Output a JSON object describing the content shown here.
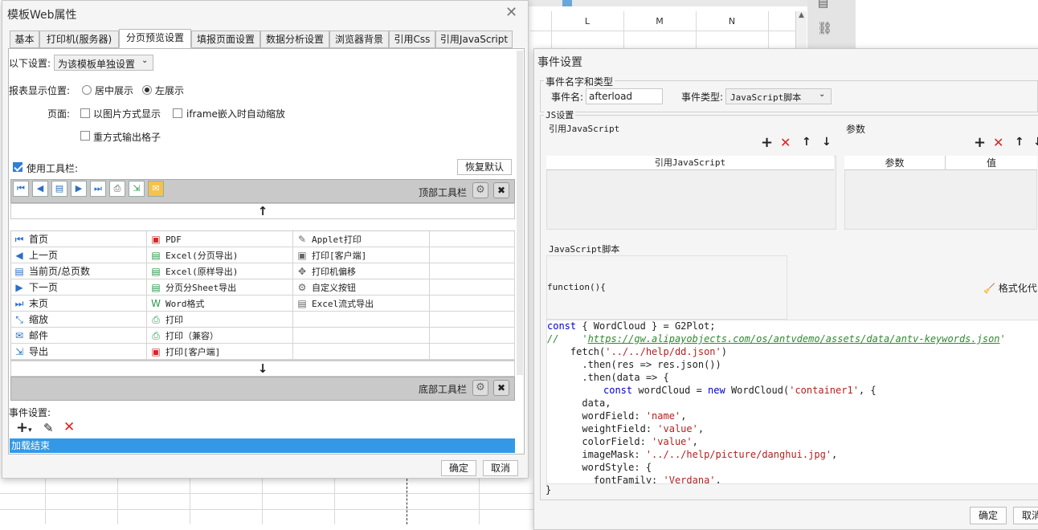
{
  "spreadsheet": {
    "columns": [
      "L",
      "M",
      "N"
    ]
  },
  "left_dialog": {
    "title": "模板Web属性",
    "tabs": [
      "基本",
      "打印机(服务器)",
      "分页预览设置",
      "填报页面设置",
      "数据分析设置",
      "浏览器背景",
      "引用Css",
      "引用JavaScript"
    ],
    "settings_label": "以下设置:",
    "settings_value": "为该模板单独设置",
    "position_label": "报表显示位置:",
    "position_center": "居中展示",
    "position_left": "左展示",
    "page_label": "页面:",
    "opt_image": "以图片方式显示",
    "opt_iframe": "iframe嵌入时自动缩放",
    "opt_grid": "重方式输出格子",
    "use_toolbar": "使用工具栏:",
    "restore_default": "恢复默认",
    "top_toolbar": "顶部工具栏",
    "bottom_toolbar": "底部工具栏",
    "up_arrow": "↑",
    "down_arrow": "↓",
    "col1": [
      "首页",
      "上一页",
      "当前页/总页数",
      "下一页",
      "末页",
      "缩放",
      "邮件",
      "导出"
    ],
    "col2": [
      "PDF",
      "Excel(分页导出)",
      "Excel(原样导出)",
      "分页分Sheet导出",
      "Word格式",
      "打印",
      "打印（兼容）",
      "打印[客户端]"
    ],
    "col3": [
      "Applet打印",
      "打印[客户端]",
      "打印机偏移",
      "自定义按钮",
      "Excel流式导出"
    ],
    "event_label": "事件设置:",
    "event_item": "加载结束",
    "ok": "确定",
    "cancel": "取消"
  },
  "right_dialog": {
    "title": "事件设置",
    "group_name": "事件名字和类型",
    "event_name_label": "事件名:",
    "event_name_value": "afterload",
    "event_type_label": "事件类型:",
    "event_type_value": "JavaScript脚本",
    "js_settings": "JS设置",
    "ref_js_label": "引用JavaScript",
    "params_label": "参数",
    "ref_js_col": "引用JavaScript",
    "param_col": "参数",
    "value_col": "值",
    "script_label": "JavaScript脚本",
    "function_sig": "function(){",
    "format_code": "格式化代",
    "closing_brace": "}",
    "ok": "确定",
    "cancel": "取消",
    "code": {
      "l1a": "const",
      "l1b": " { WordCloud } = G2Plot;",
      "l2a": "//    '",
      "l2b": "https://gw.alipayobjects.com/os/antvdemo/assets/data/antv-keywords.json",
      "l2c": "'",
      "l3a": "    fetch(",
      "l3b": "'../../help/dd.json'",
      "l3c": ")",
      "l4a": "      .then(res => res.json())",
      "l5a": "      .then(data => {",
      "l6a": "const",
      "l6b": " wordCloud = ",
      "l6c": "new",
      "l6d": " WordCloud(",
      "l6e": "'container1'",
      "l6f": ", {",
      "l7a": "      data,",
      "l8a": "      wordField: ",
      "l8b": "'name'",
      "l8c": ",",
      "l9a": "      weightField: ",
      "l9b": "'value'",
      "l9c": ",",
      "l10a": "      colorField: ",
      "l10b": "'value'",
      "l10c": ",",
      "l11a": "      imageMask: ",
      "l11b": "'../../help/picture/danghui.jpg'",
      "l11c": ",",
      "l12a": "      wordStyle: {",
      "l13a": "        fontFamily: ",
      "l13b": "'Verdana'",
      "l13c": ","
    }
  }
}
